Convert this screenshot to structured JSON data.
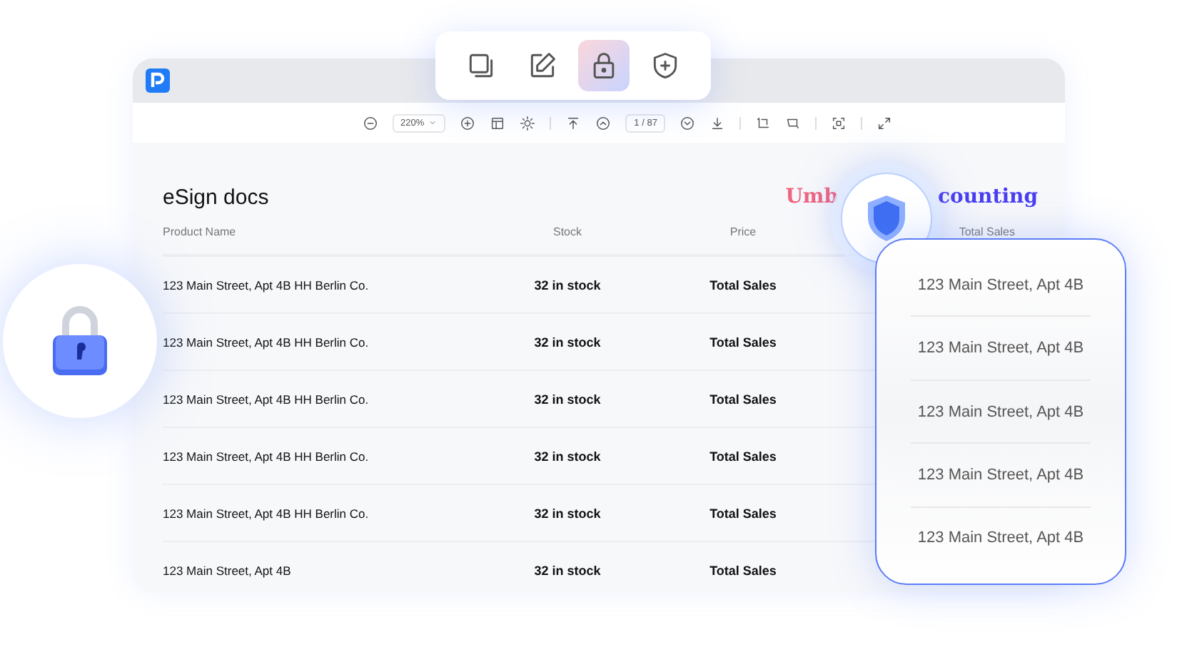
{
  "palette": {
    "tools": [
      {
        "kind": "copy",
        "selected": false
      },
      {
        "kind": "edit",
        "selected": false
      },
      {
        "kind": "lock",
        "selected": true
      },
      {
        "kind": "shield",
        "selected": false
      }
    ]
  },
  "toolbar": {
    "zoom": "220%",
    "page": "1 / 87"
  },
  "document": {
    "title": "eSign docs",
    "brand": {
      "left": "Umb",
      "right": "counting"
    },
    "columns": [
      "Product Name",
      "Stock",
      "Price",
      "Total Sales"
    ],
    "rows": [
      {
        "name": "123 Main Street, Apt 4B HH Berlin Co.",
        "stock": "32 in stock",
        "price": "Total Sales"
      },
      {
        "name": "123 Main Street, Apt 4B HH Berlin Co.",
        "stock": "32 in stock",
        "price": "Total Sales"
      },
      {
        "name": "123 Main Street, Apt 4B HH Berlin Co.",
        "stock": "32 in stock",
        "price": "Total Sales"
      },
      {
        "name": "123 Main Street, Apt 4B HH Berlin Co.",
        "stock": "32 in stock",
        "price": "Total Sales"
      },
      {
        "name": "123 Main Street, Apt 4B HH Berlin Co.",
        "stock": "32 in stock",
        "price": "Total Sales"
      },
      {
        "name": "123 Main Street, Apt 4B",
        "stock": "32 in stock",
        "price": "Total Sales"
      }
    ]
  },
  "card": {
    "items": [
      "123 Main Street, Apt 4B",
      "123 Main Street, Apt 4B",
      "123 Main Street, Apt 4B",
      "123 Main Street, Apt 4B",
      "123 Main Street, Apt 4B"
    ]
  }
}
